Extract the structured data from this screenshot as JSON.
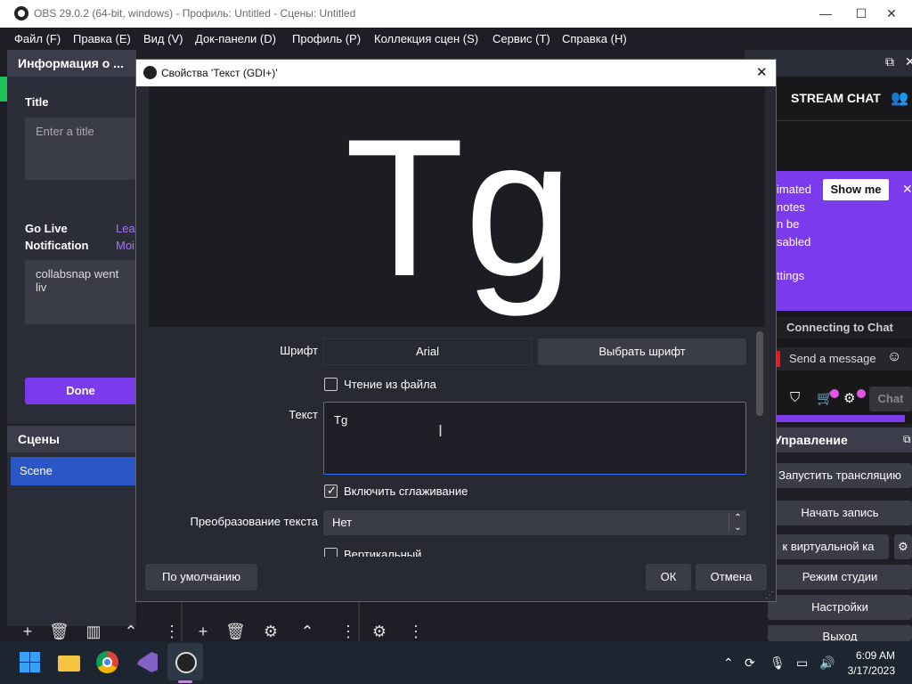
{
  "window": {
    "title": "OBS 29.0.2 (64-bit, windows) - Профиль: Untitled - Сцены: Untitled",
    "minimize": "—",
    "maximize": "☐",
    "close": "✕"
  },
  "menu": [
    "Файл (F)",
    "Правка (E)",
    "Вид (V)",
    "Док-панели (D)",
    "Профиль (P)",
    "Коллекция сцен (S)",
    "Сервис (T)",
    "Справка (H)"
  ],
  "info_dock": {
    "header": "Информация о ...",
    "title_label": "Title",
    "title_placeholder": "Enter a title",
    "go_live_label_1": "Go Live",
    "go_live_label_2": "Notification",
    "link_1": "Lea",
    "link_2": "Moi",
    "notification_text": "collabsnap went liv",
    "done": "Done"
  },
  "scenes_dock": {
    "header": "Сцены",
    "items": [
      "Scene"
    ]
  },
  "chat_dock": {
    "header": "STREAM CHAT",
    "promo_lines": [
      "imated",
      "notes",
      "n be",
      "sabled",
      "",
      "ttings"
    ],
    "show_me": "Show me",
    "connecting": "Connecting to Chat",
    "send_message": "Send a message",
    "chat_btn": "Chat"
  },
  "controls_dock": {
    "header": "Управление",
    "buttons": [
      "Запустить трансляцию",
      "Начать запись",
      "к виртуальной ка",
      "Режим студии",
      "Настройки",
      "Выход"
    ]
  },
  "dialog": {
    "title": "Свойства 'Текст (GDI+)'",
    "preview_text": "Tg",
    "font_label": "Шрифт",
    "font_value": "Arial",
    "choose_font": "Выбрать шрифт",
    "read_from_file": "Чтение из файла",
    "text_label": "Текст",
    "text_value": "Tg",
    "antialias": "Включить сглаживание",
    "transform_label": "Преобразование текста",
    "transform_value": "Нет",
    "vertical": "Вертикальный",
    "defaults": "По умолчанию",
    "ok": "ОК",
    "cancel": "Отмена"
  },
  "taskbar": {
    "time": "6:09 AM",
    "date": "3/17/2023"
  },
  "colors": {
    "accent_purple": "#7c3aed",
    "scene_blue": "#2a56c6",
    "textarea_focus": "#3a6ef5"
  }
}
